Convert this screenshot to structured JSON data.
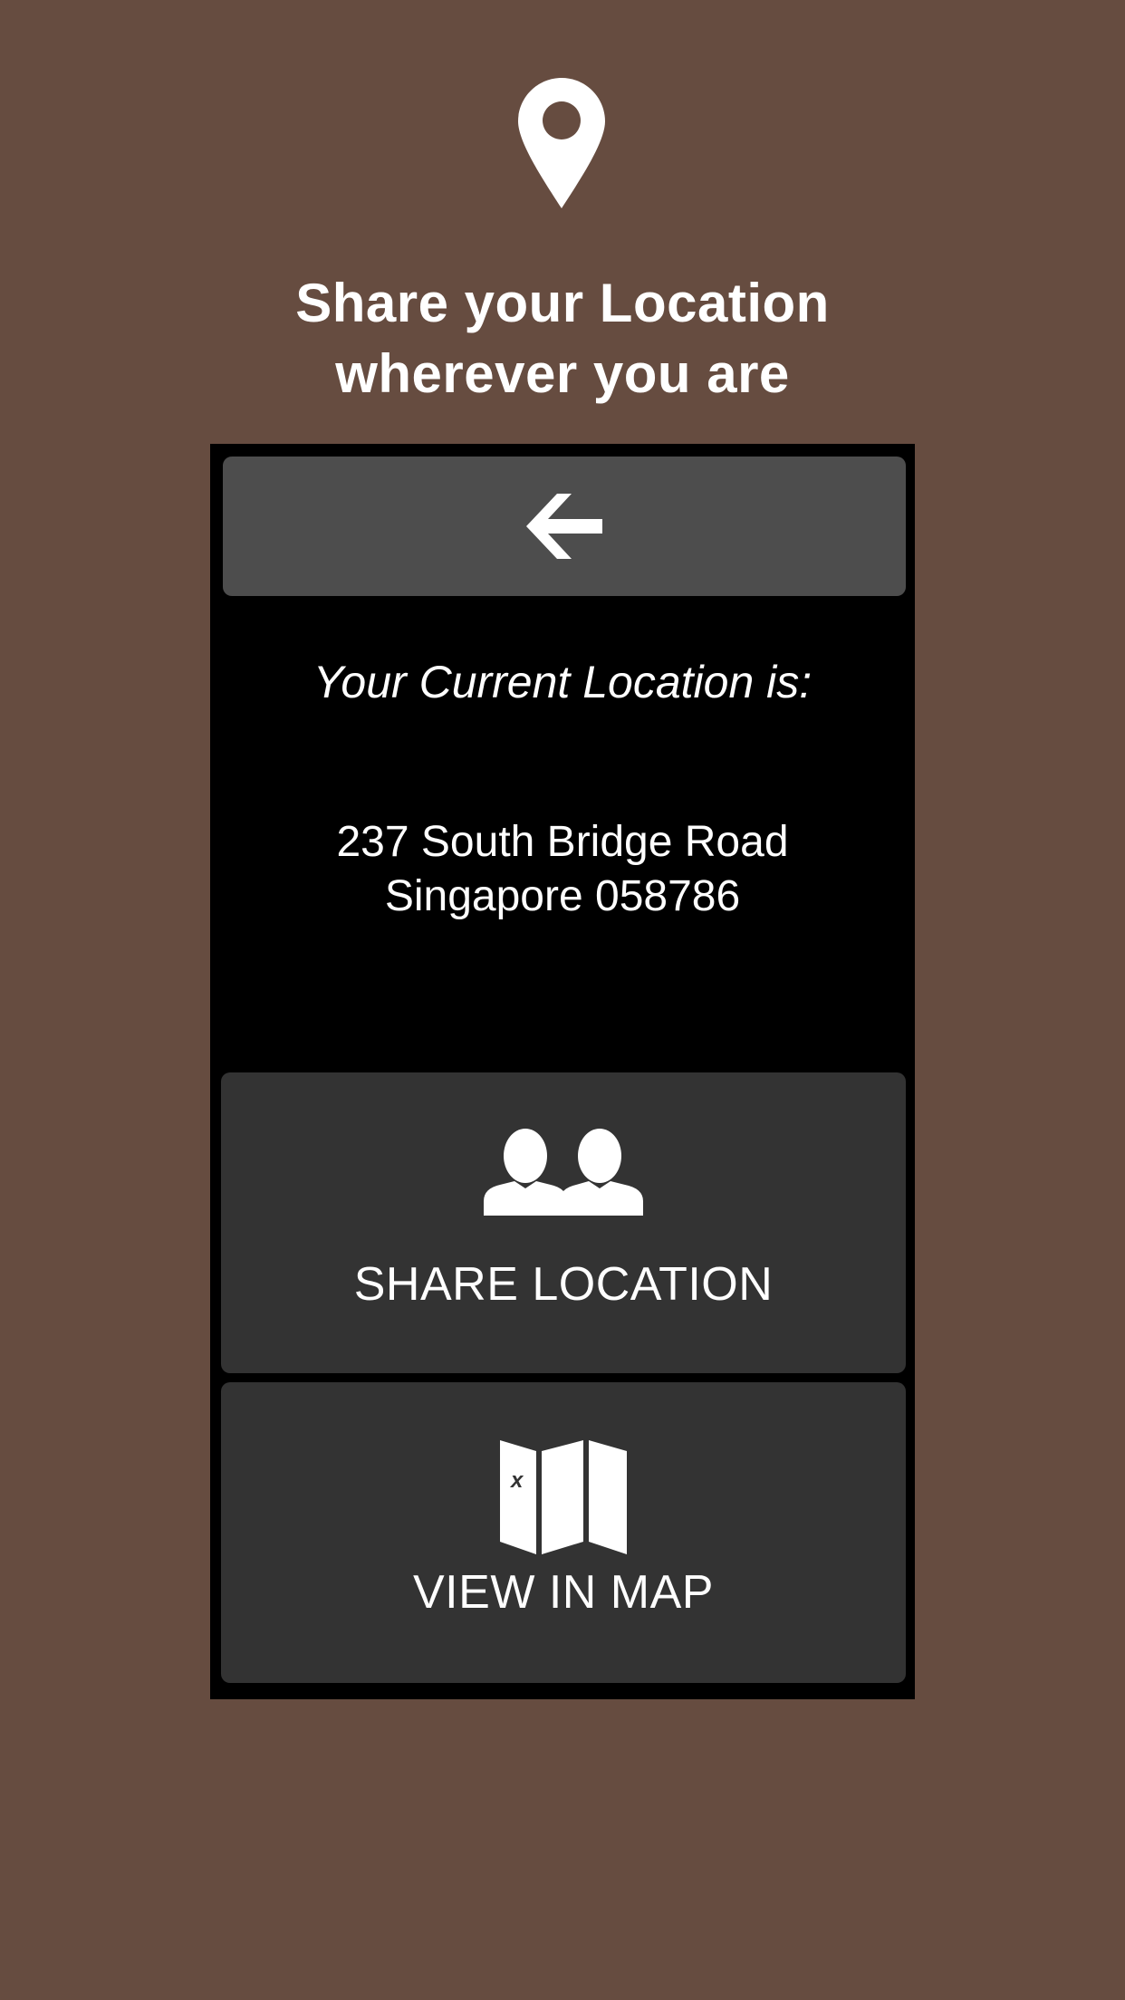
{
  "header": {
    "icon": "map-pin-icon",
    "title_line1": "Share your Location",
    "title_line2": "wherever you are"
  },
  "panel": {
    "back_icon": "arrow-left-icon",
    "caption": "Your Current Location is:",
    "address_line1": "237 South Bridge Road",
    "address_line2": "Singapore 058786"
  },
  "actions": {
    "share": {
      "icon": "people-icon",
      "label": "SHARE LOCATION"
    },
    "map": {
      "icon": "folded-map-icon",
      "label": "VIEW IN MAP",
      "marker_text": "x"
    }
  },
  "colors": {
    "background": "#664c40",
    "frame": "#000000",
    "back_button": "#4d4d4d",
    "action_button": "#333333",
    "text": "#ffffff"
  }
}
